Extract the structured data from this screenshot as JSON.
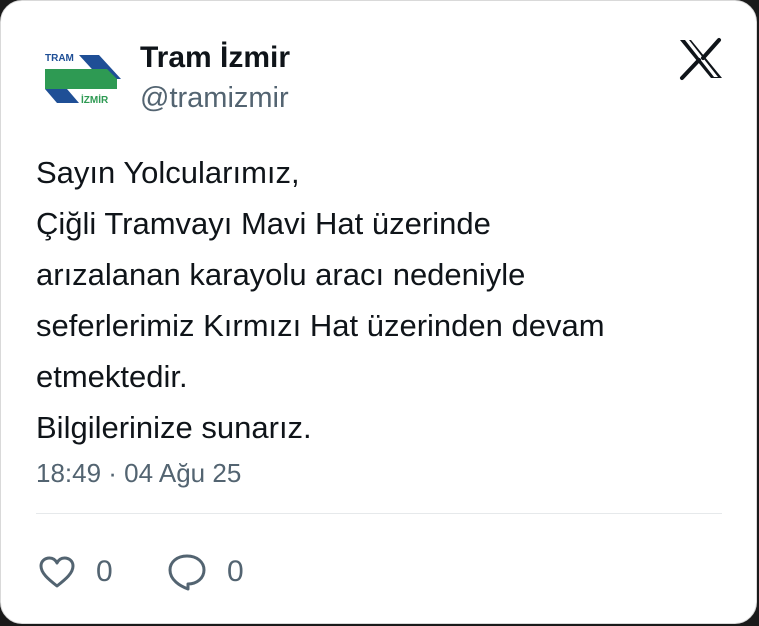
{
  "account": {
    "name": "Tram İzmir",
    "handle": "@tramizmir",
    "logo_text_top": "TRAM",
    "logo_text_bottom": "İZMİR"
  },
  "tweet": {
    "lines": [
      "Sayın Yolcularımız,",
      "Çiğli Tramvayı Mavi Hat üzerinde",
      "arızalanan karayolu aracı nedeniyle",
      "seferlerimiz Kırmızı Hat üzerinden devam",
      "etmektedir.",
      "Bilgilerinize sunarız."
    ],
    "timestamp": "18:49 · 04 Ağu 25"
  },
  "actions": {
    "likes": "0",
    "replies": "0"
  },
  "colors": {
    "logo_blue": "#1f4f96",
    "logo_green": "#2e9a53",
    "text_primary": "#0f1419",
    "text_secondary": "#536471"
  },
  "icons": {
    "brand": "x-logo-icon",
    "like": "heart-icon",
    "reply": "comment-bubble-icon"
  }
}
